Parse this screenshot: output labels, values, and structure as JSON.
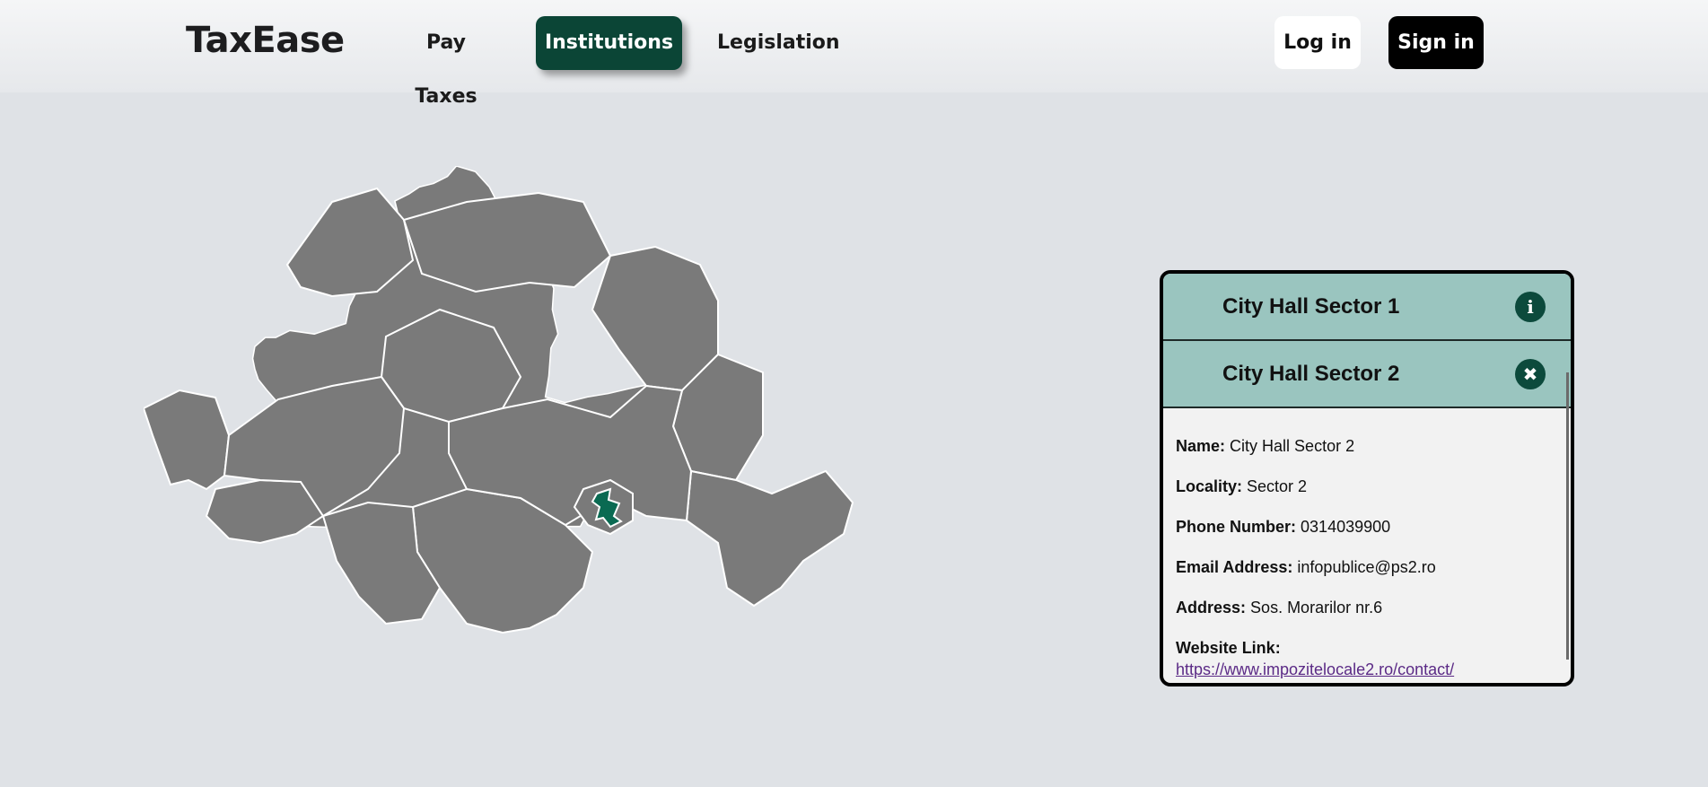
{
  "header": {
    "logo": "TaxEase",
    "nav": {
      "pay_taxes": "Pay Taxes",
      "institutions": "Institutions",
      "legislation": "Legislation"
    },
    "log_in": "Log in",
    "sign_in": "Sign in"
  },
  "colors": {
    "accent": "#0b4536",
    "map_fill": "#7a7a7a",
    "highlight": "#0a6a52",
    "accordion_header": "#9ac5bf"
  },
  "institutions": {
    "items": [
      {
        "title": "City Hall Sector 1",
        "icon": "info-icon"
      },
      {
        "title": "City Hall Sector 2",
        "icon": "close-icon"
      }
    ],
    "details": {
      "name_label": "Name:",
      "name": "City Hall Sector 2",
      "locality_label": "Locality:",
      "locality": "Sector 2",
      "phone_label": "Phone Number:",
      "phone": "0314039900",
      "email_label": "Email Address:",
      "email": "infopublice@ps2.ro",
      "address_label": "Address:",
      "address": "Sos. Morarilor nr.6",
      "website_label": "Website Link:",
      "website": " https://www.impozitelocale2.ro/contact/"
    }
  }
}
